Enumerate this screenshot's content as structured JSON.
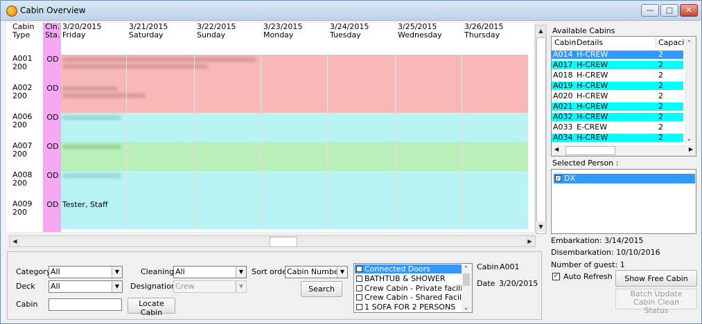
{
  "window": {
    "title": "Cabin Overview"
  },
  "grid": {
    "col_type_header": "Cabin Type",
    "col_sta_header": "Cln. Sta.",
    "dates": [
      {
        "date": "3/20/2015",
        "day": "Friday"
      },
      {
        "date": "3/21/2015",
        "day": "Saturday"
      },
      {
        "date": "3/22/2015",
        "day": "Sunday"
      },
      {
        "date": "3/23/2015",
        "day": "Monday"
      },
      {
        "date": "3/24/2015",
        "day": "Tuesday"
      },
      {
        "date": "3/25/2015",
        "day": "Wednesday"
      },
      {
        "date": "3/26/2015",
        "day": "Thursday"
      }
    ],
    "rows": [
      {
        "cabin": "A001",
        "type": "200",
        "status": "OD",
        "color": "#f8b8b8",
        "occupant": ""
      },
      {
        "cabin": "A002",
        "type": "200",
        "status": "OD",
        "color": "#f8b8b8",
        "occupant": ""
      },
      {
        "cabin": "A006",
        "type": "200",
        "status": "OD",
        "color": "#b8f4f4",
        "occupant": ""
      },
      {
        "cabin": "A007",
        "type": "200",
        "status": "OD",
        "color": "#b9f0b9",
        "occupant": ""
      },
      {
        "cabin": "A008",
        "type": "200",
        "status": "OD",
        "color": "#b8f4f4",
        "occupant": ""
      },
      {
        "cabin": "A009",
        "type": "200",
        "status": "OD",
        "color": "#b8f4f4",
        "occupant": "Tester, Staff"
      }
    ]
  },
  "available": {
    "label": "Available Cabins",
    "headers": [
      "Cabin",
      "Details",
      "Capacity"
    ],
    "rows": [
      {
        "cabin": "A014",
        "details": "H-CREW",
        "capacity": "2",
        "style": "selected"
      },
      {
        "cabin": "A017",
        "details": "H-CREW",
        "capacity": "2",
        "style": "cyan"
      },
      {
        "cabin": "A018",
        "details": "H-CREW",
        "capacity": "2",
        "style": "plain"
      },
      {
        "cabin": "A019",
        "details": "H-CREW",
        "capacity": "2",
        "style": "cyan"
      },
      {
        "cabin": "A020",
        "details": "H-CREW",
        "capacity": "2",
        "style": "plain"
      },
      {
        "cabin": "A021",
        "details": "H-CREW",
        "capacity": "2",
        "style": "cyan"
      },
      {
        "cabin": "A032",
        "details": "H-CREW",
        "capacity": "2",
        "style": "cyan"
      },
      {
        "cabin": "A033",
        "details": "E-CREW",
        "capacity": "2",
        "style": "plain"
      },
      {
        "cabin": "A034",
        "details": "H-CREW",
        "capacity": "2",
        "style": "cyan"
      }
    ]
  },
  "selected_person": {
    "label": "Selected Person :",
    "item": "DX"
  },
  "info": {
    "embarkation": "Embarkation: 3/14/2015",
    "disembarkation": "Disembarkation: 10/10/2016",
    "guests": "Number of guest: 1",
    "auto_refresh": "Auto Refresh"
  },
  "buttons": {
    "show_free": "Show Free Cabin",
    "batch_update": "Batch Update Cabin Clean Status",
    "search": "Search",
    "locate": "Locate Cabin"
  },
  "filters": {
    "category_label": "Category",
    "category_value": "All",
    "deck_label": "Deck",
    "deck_value": "All",
    "cabin_label": "Cabin",
    "cabin_value": "",
    "cleaning_label": "Cleaning",
    "cleaning_value": "All",
    "designation_label": "Designation",
    "designation_value": "Crew",
    "sort_label": "Sort order",
    "sort_value": "Cabin Number"
  },
  "features": [
    {
      "label": "Connected Doors",
      "selected": true
    },
    {
      "label": "BATHTUB & SHOWER",
      "selected": false
    },
    {
      "label": "Crew Cabin - Private facilities",
      "selected": false
    },
    {
      "label": "Crew Cabin - Shared Facilities",
      "selected": false
    },
    {
      "label": "1 SOFA FOR 2 PERSONS",
      "selected": false
    }
  ],
  "current": {
    "cabin_label": "Cabin",
    "cabin_value": "A001",
    "date_label": "Date",
    "date_value": "3/20/2015"
  },
  "colors": {
    "pink_status": "#f5a9f2",
    "selection_blue": "#3399ff",
    "cyan": "#00ffff"
  }
}
